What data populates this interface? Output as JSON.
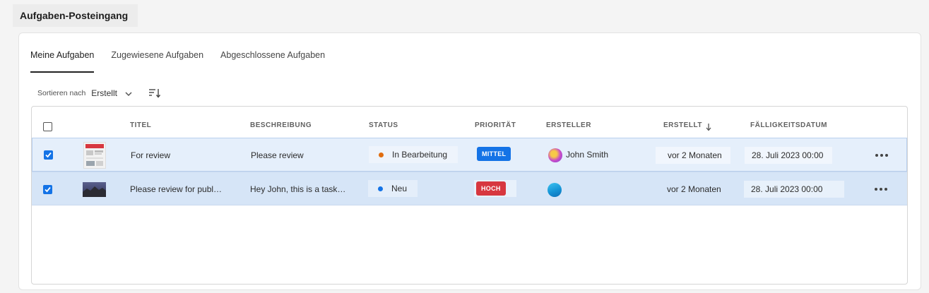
{
  "header": {
    "title": "Aufgaben-Posteingang"
  },
  "tabs": [
    {
      "label": "Meine Aufgaben",
      "active": true
    },
    {
      "label": "Zugewiesene Aufgaben",
      "active": false
    },
    {
      "label": "Abgeschlossene Aufgaben",
      "active": false
    }
  ],
  "sort": {
    "label": "Sortieren nach",
    "value": "Erstellt"
  },
  "columns": {
    "title": "TITEL",
    "description": "BESCHREIBUNG",
    "status": "STATUS",
    "priority": "PRIORITÄT",
    "creator": "ERSTELLER",
    "created": "ERSTELLT",
    "due": "FÄLLIGKEITSDATUM"
  },
  "rows": [
    {
      "selected": true,
      "title": "For review",
      "description": "Please review",
      "status": "In Bearbeitung",
      "status_color": "#e06d10",
      "priority": "MITTEL",
      "priority_color": "#1473e6",
      "creator": "John Smith",
      "created": "vor 2 Monaten",
      "due": "28. Juli 2023 00:00"
    },
    {
      "selected": true,
      "title": "Please review for publ…",
      "description": "Hey John, this is a task…",
      "status": "Neu",
      "status_color": "#1473e6",
      "priority": "HOCH",
      "priority_color": "#d7373f",
      "creator": "",
      "created": "vor 2 Monaten",
      "due": "28. Juli 2023 00:00"
    }
  ]
}
